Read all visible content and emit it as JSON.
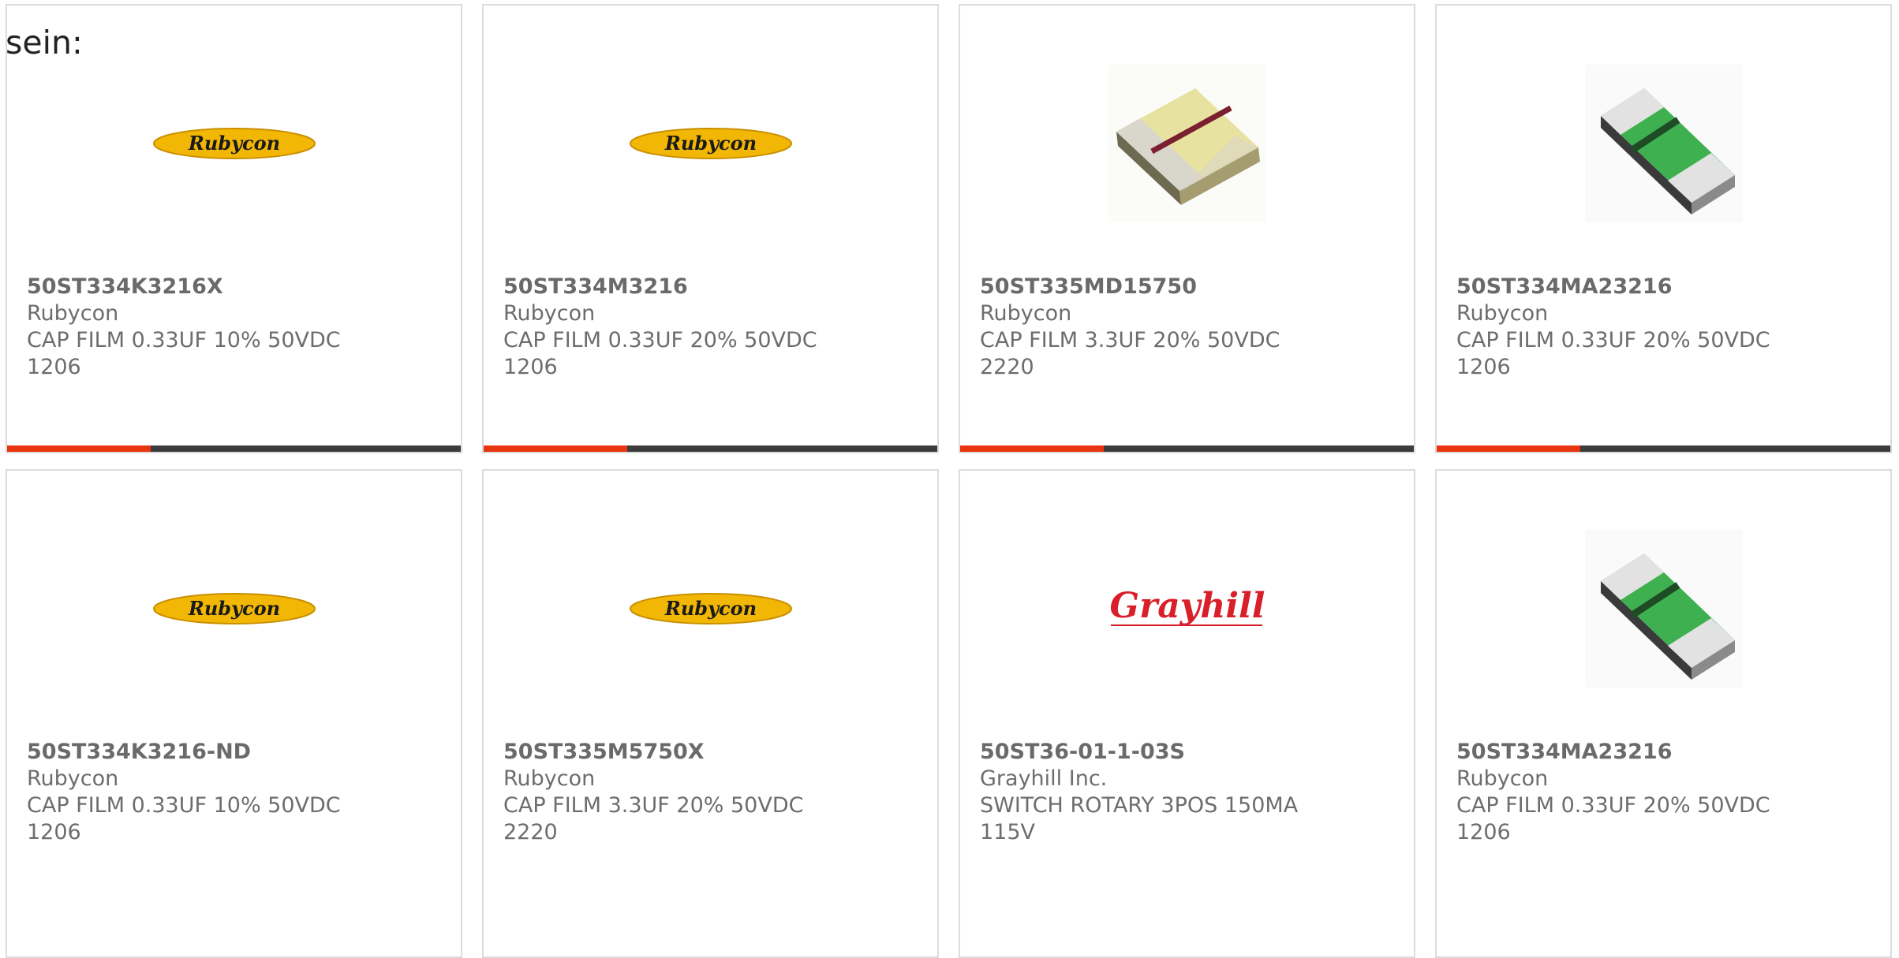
{
  "intro_text": "sein:",
  "colors": {
    "accent": "#e8340f",
    "bar": "#3c3c3c",
    "card_border": "#dcdcdc",
    "text": "#6d6d6d"
  },
  "cards": [
    {
      "part": "50ST334K3216X",
      "maker": "Rubycon",
      "desc1": "CAP FILM 0.33UF 10% 50VDC",
      "desc2": "1206",
      "image": "rubycon-logo",
      "logo_text": "Rubycon"
    },
    {
      "part": "50ST334M3216",
      "maker": "Rubycon",
      "desc1": "CAP FILM 0.33UF 20% 50VDC",
      "desc2": "1206",
      "image": "rubycon-logo",
      "logo_text": "Rubycon"
    },
    {
      "part": "50ST335MD15750",
      "maker": "Rubycon",
      "desc1": "CAP FILM 3.3UF 20% 50VDC",
      "desc2": "2220",
      "image": "yellow-chip-capacitor"
    },
    {
      "part": "50ST334MA23216",
      "maker": "Rubycon",
      "desc1": "CAP FILM 0.33UF 20% 50VDC",
      "desc2": "1206",
      "image": "green-chip-capacitor"
    },
    {
      "part": "50ST334K3216-ND",
      "maker": "Rubycon",
      "desc1": "CAP FILM 0.33UF 10% 50VDC",
      "desc2": "1206",
      "image": "rubycon-logo",
      "logo_text": "Rubycon"
    },
    {
      "part": "50ST335M5750X",
      "maker": "Rubycon",
      "desc1": "CAP FILM 3.3UF 20% 50VDC",
      "desc2": "2220",
      "image": "rubycon-logo",
      "logo_text": "Rubycon"
    },
    {
      "part": "50ST36-01-1-03S",
      "maker": "Grayhill Inc.",
      "desc1": "SWITCH ROTARY 3POS 150MA",
      "desc2": "115V",
      "image": "grayhill-logo",
      "logo_text": "Grayhill"
    },
    {
      "part": "50ST334MA23216",
      "maker": "Rubycon",
      "desc1": "CAP FILM 0.33UF 20% 50VDC",
      "desc2": "1206",
      "image": "green-chip-capacitor"
    }
  ]
}
